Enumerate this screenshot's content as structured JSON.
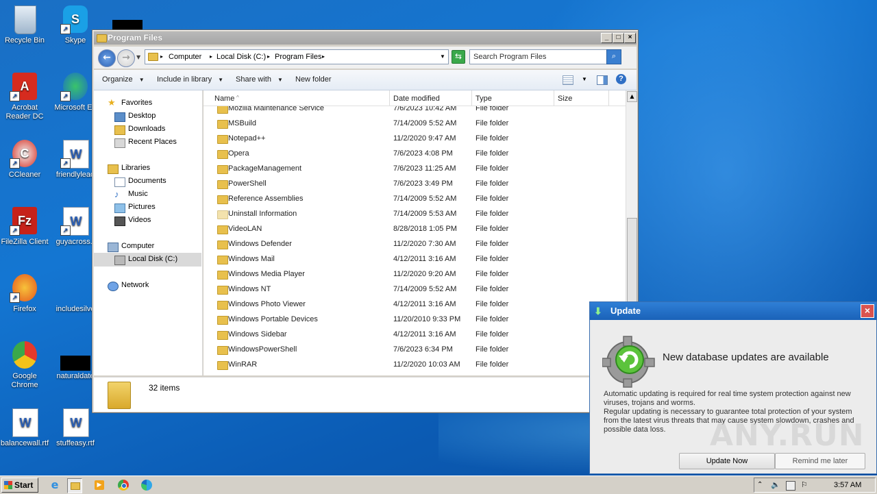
{
  "desktop": {
    "icons": [
      {
        "label": "Recycle Bin"
      },
      {
        "label": "Skype"
      },
      {
        "label": "Acrobat\nReader DC"
      },
      {
        "label": "Microsoft Ed"
      },
      {
        "label": "CCleaner"
      },
      {
        "label": "friendlylead"
      },
      {
        "label": "FileZilla Client"
      },
      {
        "label": "guyacross.r"
      },
      {
        "label": "Firefox"
      },
      {
        "label": "includesilve"
      },
      {
        "label": "Google\nChrome"
      },
      {
        "label": "naturaldate"
      },
      {
        "label": "balancewall.rtf"
      },
      {
        "label": "stuffeasy.rtf"
      }
    ]
  },
  "explorer": {
    "title": "Program Files",
    "breadcrumb": [
      "Computer",
      "Local Disk (C:)",
      "Program Files"
    ],
    "search_placeholder": "Search Program Files",
    "toolbar": {
      "organize": "Organize",
      "include": "Include in library",
      "share": "Share with",
      "new_folder": "New folder"
    },
    "nav": {
      "favorites": "Favorites",
      "desktop": "Desktop",
      "downloads": "Downloads",
      "recent": "Recent Places",
      "libraries": "Libraries",
      "documents": "Documents",
      "music": "Music",
      "pictures": "Pictures",
      "videos": "Videos",
      "computer": "Computer",
      "local_disk": "Local Disk (C:)",
      "network": "Network"
    },
    "columns": {
      "name": "Name",
      "date": "Date modified",
      "type": "Type",
      "size": "Size"
    },
    "rows": [
      {
        "name": "Mozilla Maintenance Service",
        "date": "7/6/2023 10:42 AM",
        "type": "File folder"
      },
      {
        "name": "MSBuild",
        "date": "7/14/2009 5:52 AM",
        "type": "File folder"
      },
      {
        "name": "Notepad++",
        "date": "11/2/2020 9:47 AM",
        "type": "File folder"
      },
      {
        "name": "Opera",
        "date": "7/6/2023 4:08 PM",
        "type": "File folder"
      },
      {
        "name": "PackageManagement",
        "date": "7/6/2023 11:25 AM",
        "type": "File folder"
      },
      {
        "name": "PowerShell",
        "date": "7/6/2023 3:49 PM",
        "type": "File folder"
      },
      {
        "name": "Reference Assemblies",
        "date": "7/14/2009 5:52 AM",
        "type": "File folder"
      },
      {
        "name": "Uninstall Information",
        "date": "7/14/2009 5:53 AM",
        "type": "File folder"
      },
      {
        "name": "VideoLAN",
        "date": "8/28/2018 1:05 PM",
        "type": "File folder"
      },
      {
        "name": "Windows Defender",
        "date": "11/2/2020 7:30 AM",
        "type": "File folder"
      },
      {
        "name": "Windows Mail",
        "date": "4/12/2011 3:16 AM",
        "type": "File folder"
      },
      {
        "name": "Windows Media Player",
        "date": "11/2/2020 9:20 AM",
        "type": "File folder"
      },
      {
        "name": "Windows NT",
        "date": "7/14/2009 5:52 AM",
        "type": "File folder"
      },
      {
        "name": "Windows Photo Viewer",
        "date": "4/12/2011 3:16 AM",
        "type": "File folder"
      },
      {
        "name": "Windows Portable Devices",
        "date": "11/20/2010 9:33 PM",
        "type": "File folder"
      },
      {
        "name": "Windows Sidebar",
        "date": "4/12/2011 3:16 AM",
        "type": "File folder"
      },
      {
        "name": "WindowsPowerShell",
        "date": "7/6/2023 6:34 PM",
        "type": "File folder"
      },
      {
        "name": "WinRAR",
        "date": "11/2/2020 10:03 AM",
        "type": "File folder"
      }
    ],
    "status": "32 items"
  },
  "update_popup": {
    "title": "Update",
    "heading": "New database updates are available",
    "body1": "Automatic updating is required for real time system protection against new viruses, trojans and worms.",
    "body2": "Regular updating is necessary to guarantee total protection of your system from the latest virus threats that may cause system slowdown, crashes and possible data loss.",
    "update_now": "Update Now",
    "remind": "Remind me later"
  },
  "watermark": "ANY.RUN",
  "taskbar": {
    "start": "Start",
    "clock": "3:57 AM"
  }
}
